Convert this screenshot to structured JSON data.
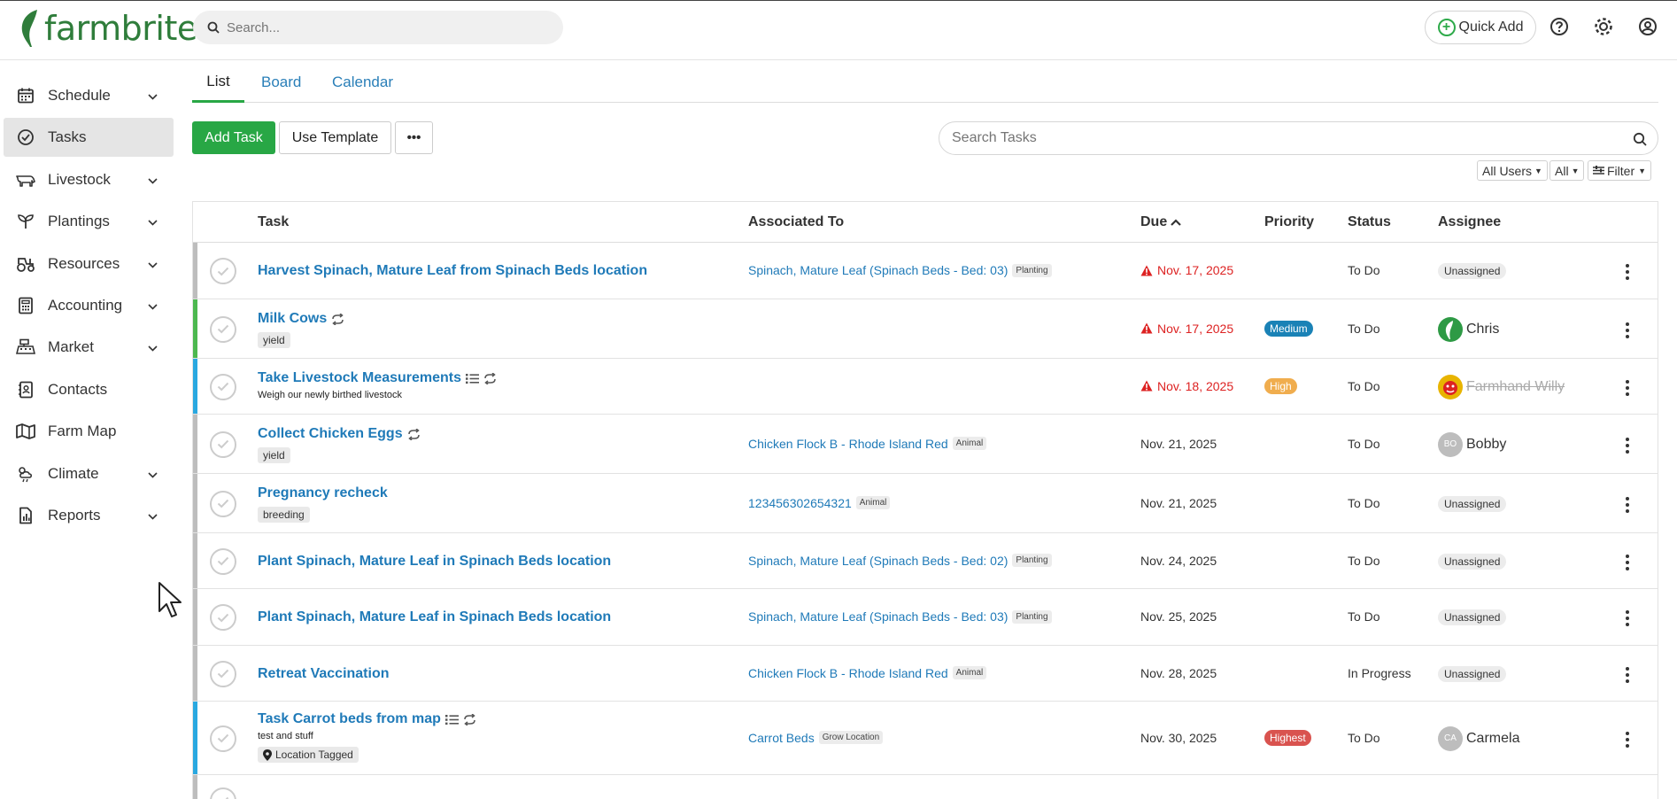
{
  "brand": {
    "name": "farmbrite",
    "color": "#2f7d3b"
  },
  "top_search": {
    "placeholder": "Search..."
  },
  "header": {
    "quick_add_label": "Quick Add"
  },
  "sidebar": {
    "items": [
      {
        "label": "Schedule",
        "icon": "calendar-icon",
        "expandable": true,
        "active": false
      },
      {
        "label": "Tasks",
        "icon": "check-circle-icon",
        "expandable": false,
        "active": true
      },
      {
        "label": "Livestock",
        "icon": "livestock-icon",
        "expandable": true,
        "active": false
      },
      {
        "label": "Plantings",
        "icon": "sprout-icon",
        "expandable": true,
        "active": false
      },
      {
        "label": "Resources",
        "icon": "tractor-icon",
        "expandable": true,
        "active": false
      },
      {
        "label": "Accounting",
        "icon": "calculator-icon",
        "expandable": true,
        "active": false
      },
      {
        "label": "Market",
        "icon": "register-icon",
        "expandable": true,
        "active": false
      },
      {
        "label": "Contacts",
        "icon": "contacts-icon",
        "expandable": false,
        "active": false
      },
      {
        "label": "Farm Map",
        "icon": "map-icon",
        "expandable": false,
        "active": false
      },
      {
        "label": "Climate",
        "icon": "weather-icon",
        "expandable": true,
        "active": false
      },
      {
        "label": "Reports",
        "icon": "report-icon",
        "expandable": true,
        "active": false
      }
    ]
  },
  "tabs": [
    {
      "label": "List",
      "active": true
    },
    {
      "label": "Board",
      "active": false
    },
    {
      "label": "Calendar",
      "active": false
    }
  ],
  "toolbar": {
    "add_task_label": "Add Task",
    "use_template_label": "Use Template",
    "more_label": "•••",
    "search_placeholder": "Search Tasks",
    "all_users_label": "All Users",
    "all_label": "All",
    "filter_label": "Filter"
  },
  "table": {
    "columns": {
      "task": "Task",
      "associated": "Associated To",
      "due": "Due",
      "priority": "Priority",
      "status": "Status",
      "assignee": "Assignee"
    },
    "rows": [
      {
        "title": "Harvest Spinach, Mature Leaf from Spinach Beds location",
        "icons": [],
        "sub": "",
        "tag": "",
        "bar_color": "#bdbdbd",
        "assoc": "Spinach, Mature Leaf (Spinach Beds - Bed: 03)",
        "assoc_tag": "Planting",
        "due": "Nov. 17, 2025",
        "overdue": true,
        "priority": "",
        "priority_color": "",
        "status": "To Do",
        "assignee": "Unassigned",
        "assignee_type": "unassigned",
        "avatar_initials": ""
      },
      {
        "title": "Milk Cows",
        "icons": [
          "repeat-icon"
        ],
        "sub": "",
        "tag": "yield",
        "bar_color": "#4cb84f",
        "assoc": "",
        "assoc_tag": "",
        "due": "Nov. 17, 2025",
        "overdue": true,
        "priority": "Medium",
        "priority_color": "#1a82b6",
        "status": "To Do",
        "assignee": "Chris",
        "assignee_type": "logo",
        "avatar_initials": ""
      },
      {
        "title": "Take Livestock Measurements",
        "icons": [
          "checklist-icon",
          "repeat-icon"
        ],
        "sub": "Weigh our newly birthed livestock",
        "tag": "",
        "bar_color": "#29a8e0",
        "assoc": "",
        "assoc_tag": "",
        "due": "Nov. 18, 2025",
        "overdue": true,
        "priority": "High",
        "priority_color": "#f0ad4e",
        "status": "To Do",
        "assignee": "Farmhand Willy",
        "assignee_type": "strike",
        "avatar_initials": ""
      },
      {
        "title": "Collect Chicken Eggs",
        "icons": [
          "repeat-icon"
        ],
        "sub": "",
        "tag": "yield",
        "bar_color": "#bdbdbd",
        "assoc": "Chicken Flock B - Rhode Island Red",
        "assoc_tag": "Animal",
        "due": "Nov. 21, 2025",
        "overdue": false,
        "priority": "",
        "priority_color": "",
        "status": "To Do",
        "assignee": "Bobby",
        "assignee_type": "initials",
        "avatar_initials": "BO"
      },
      {
        "title": "Pregnancy recheck",
        "icons": [],
        "sub": "",
        "tag": "breeding",
        "bar_color": "#bdbdbd",
        "assoc": "123456302654321",
        "assoc_tag": "Animal",
        "due": "Nov. 21, 2025",
        "overdue": false,
        "priority": "",
        "priority_color": "",
        "status": "To Do",
        "assignee": "Unassigned",
        "assignee_type": "unassigned",
        "avatar_initials": ""
      },
      {
        "title": "Plant Spinach, Mature Leaf in Spinach Beds location",
        "icons": [],
        "sub": "",
        "tag": "",
        "bar_color": "#bdbdbd",
        "assoc": "Spinach, Mature Leaf (Spinach Beds - Bed: 02)",
        "assoc_tag": "Planting",
        "due": "Nov. 24, 2025",
        "overdue": false,
        "priority": "",
        "priority_color": "",
        "status": "To Do",
        "assignee": "Unassigned",
        "assignee_type": "unassigned",
        "avatar_initials": ""
      },
      {
        "title": "Plant Spinach, Mature Leaf in Spinach Beds location",
        "icons": [],
        "sub": "",
        "tag": "",
        "bar_color": "#bdbdbd",
        "assoc": "Spinach, Mature Leaf (Spinach Beds - Bed: 03)",
        "assoc_tag": "Planting",
        "due": "Nov. 25, 2025",
        "overdue": false,
        "priority": "",
        "priority_color": "",
        "status": "To Do",
        "assignee": "Unassigned",
        "assignee_type": "unassigned",
        "avatar_initials": ""
      },
      {
        "title": "Retreat Vaccination",
        "icons": [],
        "sub": "",
        "tag": "",
        "bar_color": "#bdbdbd",
        "assoc": "Chicken Flock B - Rhode Island Red",
        "assoc_tag": "Animal",
        "due": "Nov. 28, 2025",
        "overdue": false,
        "priority": "",
        "priority_color": "",
        "status": "In Progress",
        "assignee": "Unassigned",
        "assignee_type": "unassigned",
        "avatar_initials": ""
      },
      {
        "title": "Task Carrot beds from map",
        "icons": [
          "checklist-icon",
          "repeat-icon"
        ],
        "sub": "test and stuff",
        "tag": "Location Tagged",
        "tag_icon": "map-pin-icon",
        "bar_color": "#29a8e0",
        "assoc": "Carrot Beds",
        "assoc_tag": "Grow Location",
        "due": "Nov. 30, 2025",
        "overdue": false,
        "priority": "Highest",
        "priority_color": "#d9534f",
        "status": "To Do",
        "assignee": "Carmela",
        "assignee_type": "initials",
        "avatar_initials": "CA"
      }
    ]
  }
}
